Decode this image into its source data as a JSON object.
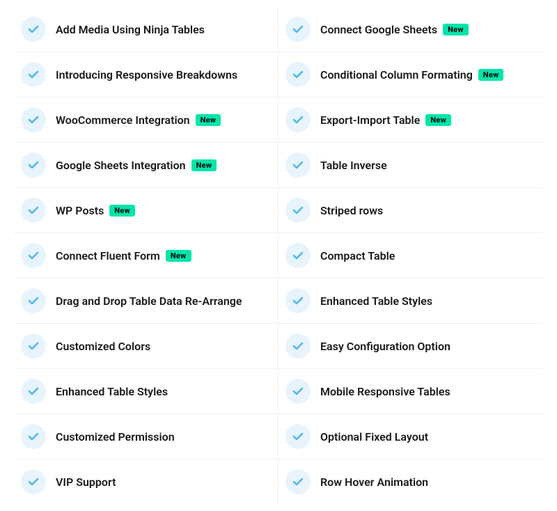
{
  "features": {
    "left": [
      {
        "label": "Add Media Using Ninja Tables",
        "badge": null
      },
      {
        "label": "Introducing Responsive Breakdowns",
        "badge": null
      },
      {
        "label": "WooCommerce Integration",
        "badge": "New"
      },
      {
        "label": "Google Sheets Integration",
        "badge": "New"
      },
      {
        "label": "WP Posts",
        "badge": "New"
      },
      {
        "label": "Connect Fluent Form",
        "badge": "New"
      },
      {
        "label": "Drag and Drop Table Data Re-Arrange",
        "badge": null
      },
      {
        "label": "Customized Colors",
        "badge": null
      },
      {
        "label": "Enhanced Table Styles",
        "badge": null
      },
      {
        "label": "Customized Permission",
        "badge": null
      },
      {
        "label": "VIP Support",
        "badge": null
      }
    ],
    "right": [
      {
        "label": "Connect Google Sheets",
        "badge": "New"
      },
      {
        "label": "Conditional Column Formating",
        "badge": "New"
      },
      {
        "label": "Export-Import Table",
        "badge": "New"
      },
      {
        "label": "Table Inverse",
        "badge": null
      },
      {
        "label": "Striped rows",
        "badge": null
      },
      {
        "label": "Compact Table",
        "badge": null
      },
      {
        "label": "Enhanced Table Styles",
        "badge": null
      },
      {
        "label": "Easy Configuration Option",
        "badge": null
      },
      {
        "label": "Mobile Responsive Tables",
        "badge": null
      },
      {
        "label": "Optional Fixed Layout",
        "badge": null
      },
      {
        "label": "Row Hover Animation",
        "badge": null
      }
    ],
    "badge_label": "New",
    "check_color": "#4ab8e8"
  }
}
